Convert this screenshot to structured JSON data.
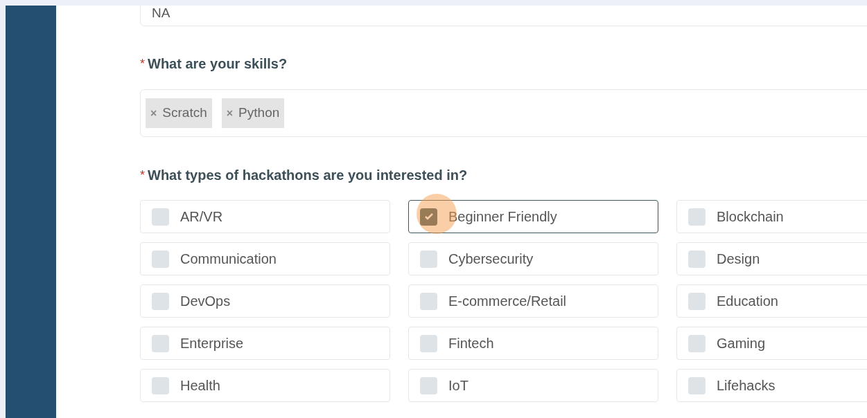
{
  "previous_field": {
    "value": "NA"
  },
  "skills_question": {
    "required_mark": "*",
    "label": "What are your skills?"
  },
  "skills": [
    {
      "remove": "×",
      "label": "Scratch"
    },
    {
      "remove": "×",
      "label": "Python"
    }
  ],
  "interests_question": {
    "required_mark": "*",
    "label": "What types of hackathons are you interested in?"
  },
  "interests": [
    {
      "label": "AR/VR",
      "checked": false,
      "focused": false
    },
    {
      "label": "Beginner Friendly",
      "checked": true,
      "focused": true
    },
    {
      "label": "Blockchain",
      "checked": false,
      "focused": false
    },
    {
      "label": "Communication",
      "checked": false,
      "focused": false
    },
    {
      "label": "Cybersecurity",
      "checked": false,
      "focused": false
    },
    {
      "label": "Design",
      "checked": false,
      "focused": false
    },
    {
      "label": "DevOps",
      "checked": false,
      "focused": false
    },
    {
      "label": "E-commerce/Retail",
      "checked": false,
      "focused": false
    },
    {
      "label": "Education",
      "checked": false,
      "focused": false
    },
    {
      "label": "Enterprise",
      "checked": false,
      "focused": false
    },
    {
      "label": "Fintech",
      "checked": false,
      "focused": false
    },
    {
      "label": "Gaming",
      "checked": false,
      "focused": false
    },
    {
      "label": "Health",
      "checked": false,
      "focused": false
    },
    {
      "label": "IoT",
      "checked": false,
      "focused": false
    },
    {
      "label": "Lifehacks",
      "checked": false,
      "focused": false
    }
  ]
}
